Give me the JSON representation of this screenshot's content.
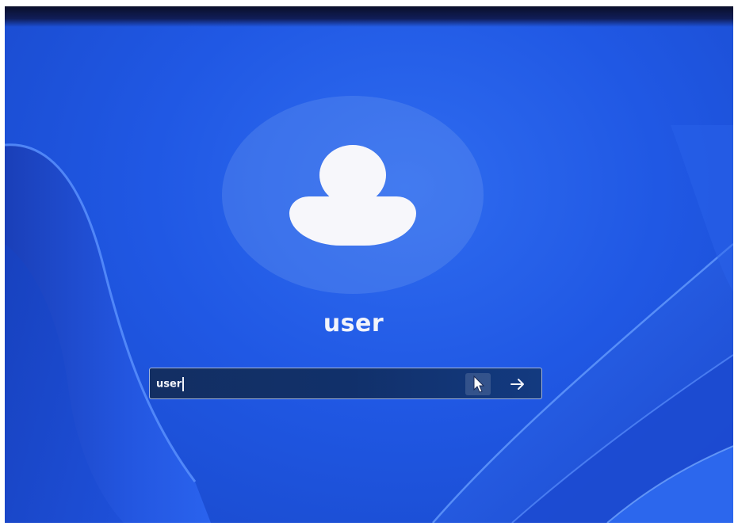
{
  "user": {
    "display_name": "user"
  },
  "password_field": {
    "value": "user"
  },
  "icons": {
    "avatar": "user-avatar-icon",
    "reveal": "eye-reveal-icon",
    "submit": "arrow-right-icon",
    "cursor": "mouse-pointer-icon"
  },
  "colors": {
    "background": "#2058e4",
    "field_background": "#132f63",
    "text": "#f2f4fb"
  }
}
